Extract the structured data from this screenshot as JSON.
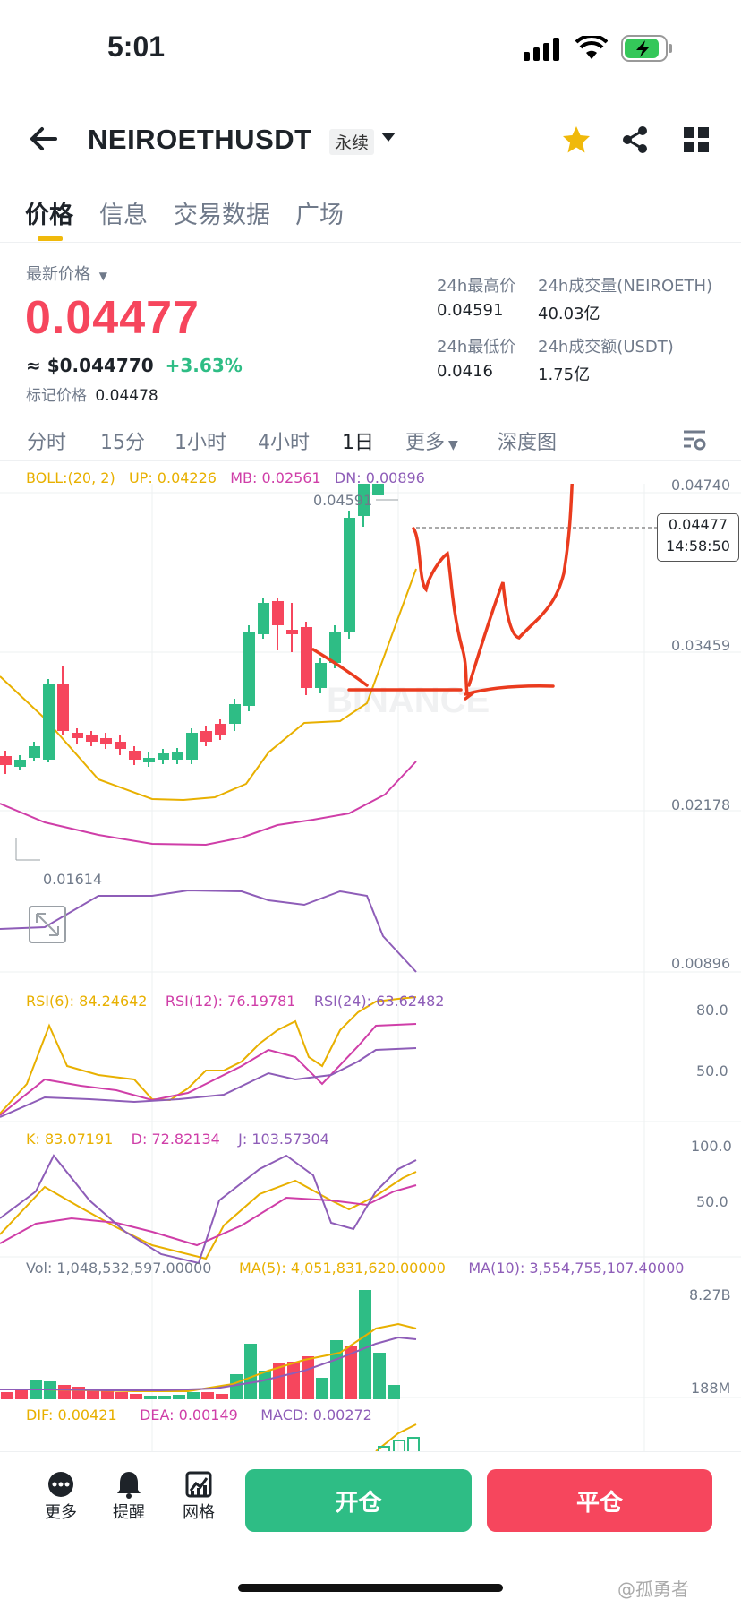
{
  "status_bar": {
    "time": "5:01"
  },
  "header": {
    "symbol": "NEIROETHUSDT",
    "contract_type": "永续",
    "icons": [
      "back-arrow-icon",
      "chevron-down-icon",
      "star-icon",
      "share-icon",
      "grid-icon"
    ],
    "colors": {
      "star": "#f0b90b"
    }
  },
  "tabs": [
    {
      "label": "价格",
      "active": true
    },
    {
      "label": "信息"
    },
    {
      "label": "交易数据"
    },
    {
      "label": "广场"
    }
  ],
  "price_panel": {
    "latest_label": "最新价格",
    "price": "0.04477",
    "usd_approx": "≈ $0.044770",
    "change_pct": "+3.63%",
    "mark_label": "标记价格",
    "mark_price": "0.04478",
    "colors": {
      "down": "#f6465d",
      "up": "#2ebd85"
    }
  },
  "stats": {
    "high_label": "24h最高价",
    "high": "0.04591",
    "vol_label": "24h成交量(NEIROETH)",
    "vol": "40.03亿",
    "low_label": "24h最低价",
    "low": "0.0416",
    "amount_label": "24h成交额(USDT)",
    "amount": "1.75亿"
  },
  "intervals": [
    {
      "label": "分时"
    },
    {
      "label": "15分"
    },
    {
      "label": "1小时"
    },
    {
      "label": "4小时"
    },
    {
      "label": "1日",
      "active": true
    },
    {
      "label": "更多"
    },
    {
      "label": "深度图"
    }
  ],
  "chart": {
    "boll": {
      "label": "BOLL:(20, 2)",
      "up": "UP: 0.04226",
      "mb": "MB: 0.02561",
      "dn": "DN: 0.00896"
    },
    "y_axis": [
      "0.04740",
      "0.03459",
      "0.02178",
      "0.00896"
    ],
    "high_marker": "0.04591",
    "low_marker": "0.01614",
    "current_price_tag": "0.04477",
    "countdown": "14:58:50",
    "watermark": "BINANCE",
    "rsi": {
      "r6": "RSI(6): 84.24642",
      "r12": "RSI(12): 76.19781",
      "r24": "RSI(24): 63.62482",
      "axis": [
        "80.0",
        "50.0"
      ]
    },
    "kdj": {
      "k": "K: 83.07191",
      "d": "D: 72.82134",
      "j": "J: 103.57304",
      "axis": [
        "100.0",
        "50.0"
      ]
    },
    "vol": {
      "vol": "Vol: 1,048,532,597.00000",
      "ma5": "MA(5): 4,051,831,620.00000",
      "ma10": "MA(10): 3,554,755,107.40000",
      "axis": [
        "8.27B",
        "188M"
      ]
    },
    "macd": {
      "dif": "DIF: 0.00421",
      "dea": "DEA: 0.00149",
      "macd": "MACD: 0.00272"
    }
  },
  "bottom_bar": {
    "more": "更多",
    "alert": "提醒",
    "grid": "网格",
    "open": "开仓",
    "close": "平仓"
  },
  "watermark_text": "@孤勇者"
}
